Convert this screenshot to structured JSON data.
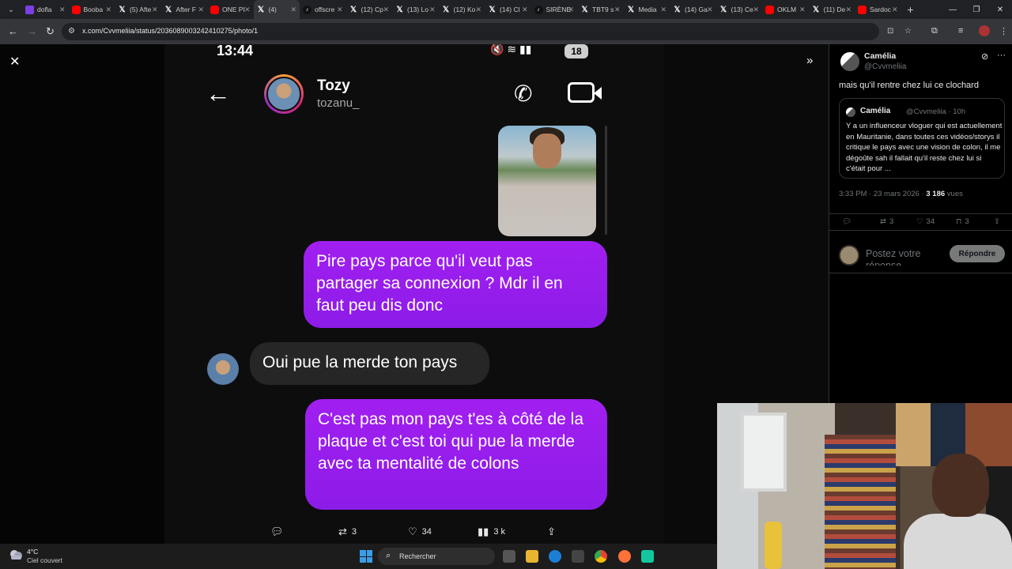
{
  "browser": {
    "tabs": [
      {
        "label": "dofla",
        "icon": "purple"
      },
      {
        "label": "Booba",
        "icon": "yt"
      },
      {
        "label": "(5) Afte",
        "icon": "x"
      },
      {
        "label": "After F",
        "icon": "x"
      },
      {
        "label": "ONE PI",
        "icon": "yt"
      },
      {
        "label": "(4)",
        "icon": "x",
        "active": true
      },
      {
        "label": "offscre",
        "icon": "tt"
      },
      {
        "label": "(12) Cp",
        "icon": "x"
      },
      {
        "label": "(13) Lo",
        "icon": "x"
      },
      {
        "label": "(12) Ko",
        "icon": "x"
      },
      {
        "label": "(14) Cl",
        "icon": "x"
      },
      {
        "label": "SIRÈNE",
        "icon": "tt"
      },
      {
        "label": "TBT9 s",
        "icon": "x"
      },
      {
        "label": "Media",
        "icon": "x"
      },
      {
        "label": "(14) Ga",
        "icon": "x"
      },
      {
        "label": "(13) Ce",
        "icon": "x"
      },
      {
        "label": "OKLM",
        "icon": "yt"
      },
      {
        "label": "(11) De",
        "icon": "x"
      },
      {
        "label": "Sardoc",
        "icon": "yt"
      }
    ],
    "url": "x.com/Cvvmeliia/status/2036089003242410275/photo/1"
  },
  "phone": {
    "time": "13:44",
    "battery": "18",
    "contact_name": "Tozy",
    "contact_handle": "tozanu_",
    "messages": [
      {
        "id": "b1",
        "dir": "out",
        "text": "Pire pays parce qu'il veut pas partager sa connexion ? Mdr il en faut peu dis donc"
      },
      {
        "id": "b2",
        "dir": "in",
        "text": "Oui pue la merde ton pays"
      },
      {
        "id": "b3",
        "dir": "out",
        "text": "C'est pas mon pays t'es à côté de la plaque et c'est toi qui pue la merde avec ta mentalité de colons"
      }
    ]
  },
  "photo_actions": {
    "retweets": "3",
    "likes": "34",
    "views": "3 k"
  },
  "tweet": {
    "author": "Camélia",
    "handle": "@Cvvmeliia",
    "text": "mais qu'il rentre chez lui ce clochard",
    "quote": {
      "author": "Camélia",
      "meta": "@Cvvmeliia · 10h",
      "text": "Y a un influenceur vloguer qui est actuellement en Mauritanie, dans toutes ces vidéos/storys il critique le pays avec une vision de colon, il me dégoûte sah il fallait qu'il reste chez lui si c'était pour ..."
    },
    "timestamp": "3:33 PM · 23 mars 2026 · ",
    "views_count": "3 186",
    "views_label": " vues",
    "stats": {
      "retweets": "3",
      "likes": "34",
      "bookmarks": "3"
    },
    "reply_placeholder": "Postez votre réponse",
    "reply_button": "Répondre"
  },
  "taskbar": {
    "temperature": "4°C",
    "weather": "Ciel couvert",
    "search_placeholder": "Rechercher"
  }
}
